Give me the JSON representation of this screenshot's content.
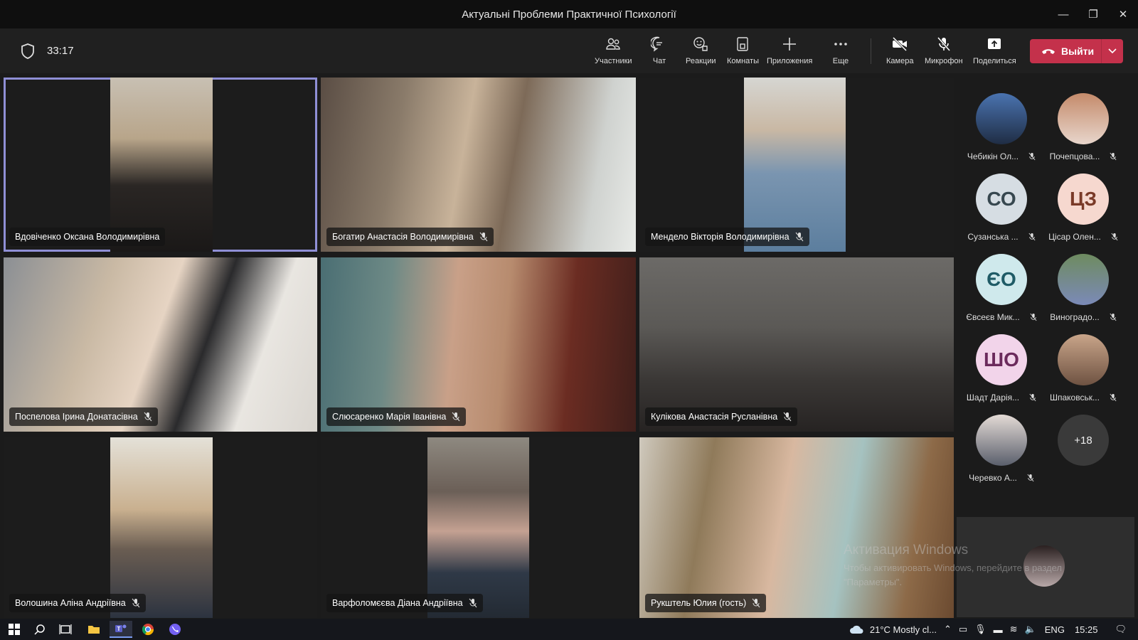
{
  "window": {
    "title": "Актуальні Проблеми Практичної Психології"
  },
  "meeting": {
    "timer": "33:17"
  },
  "toolbar": {
    "participants": "Участники",
    "chat": "Чат",
    "reactions": "Реакции",
    "rooms": "Комнаты",
    "apps": "Приложения",
    "more": "Еще",
    "camera": "Камера",
    "mic": "Микрофон",
    "share": "Поделиться",
    "leave": "Выйти"
  },
  "tiles": [
    {
      "name": "Вдовіченко Оксана Володимирівна",
      "muted": false,
      "active": true
    },
    {
      "name": "Богатир Анастасія Володимирівна",
      "muted": true,
      "active": false
    },
    {
      "name": "Мендело Вікторія Володимирівна",
      "muted": true,
      "active": false
    },
    {
      "name": "Поспелова Ірина Донатасівна",
      "muted": true,
      "active": false
    },
    {
      "name": "Слюсаренко Марія Іванівна",
      "muted": true,
      "active": false
    },
    {
      "name": "Кулікова Анастасія Русланівна",
      "muted": true,
      "active": false
    },
    {
      "name": "Волошина Аліна Андріївна",
      "muted": true,
      "active": false
    },
    {
      "name": "Варфоломєєва Діана Андріївна",
      "muted": true,
      "active": false
    },
    {
      "name": "Рукштель Юлия (гость)",
      "muted": true,
      "active": false
    }
  ],
  "roster": [
    {
      "name": "Чебикін Ол...",
      "initials": "",
      "color": "#3a5a8c"
    },
    {
      "name": "Почепцова...",
      "initials": "",
      "color": "#b98a7c"
    },
    {
      "name": "Сузанська ...",
      "initials": "СО",
      "color": "#d6dde3"
    },
    {
      "name": "Цісар Олен...",
      "initials": "ЦЗ",
      "color": "#f6d8cf"
    },
    {
      "name": "Євсеєв Мик...",
      "initials": "ЄО",
      "color": "#cfe9ec"
    },
    {
      "name": "Виноградо...",
      "initials": "",
      "color": "#4f7a56"
    },
    {
      "name": "Шадт Дарія...",
      "initials": "ШО",
      "color": "#f2d4ea"
    },
    {
      "name": "Шпаковськ...",
      "initials": "",
      "color": "#a98470"
    },
    {
      "name": "Черевко А...",
      "initials": "",
      "color": "#8c8f99"
    }
  ],
  "overflow": {
    "label": "+18"
  },
  "watermark": {
    "line1": "Активация Windows",
    "line2": "Чтобы активировать Windows, перейдите в раздел",
    "line3": "\"Параметры\"."
  },
  "taskbar": {
    "weather": "21°C  Mostly cl...",
    "lang": "ENG",
    "time": "15:25"
  }
}
